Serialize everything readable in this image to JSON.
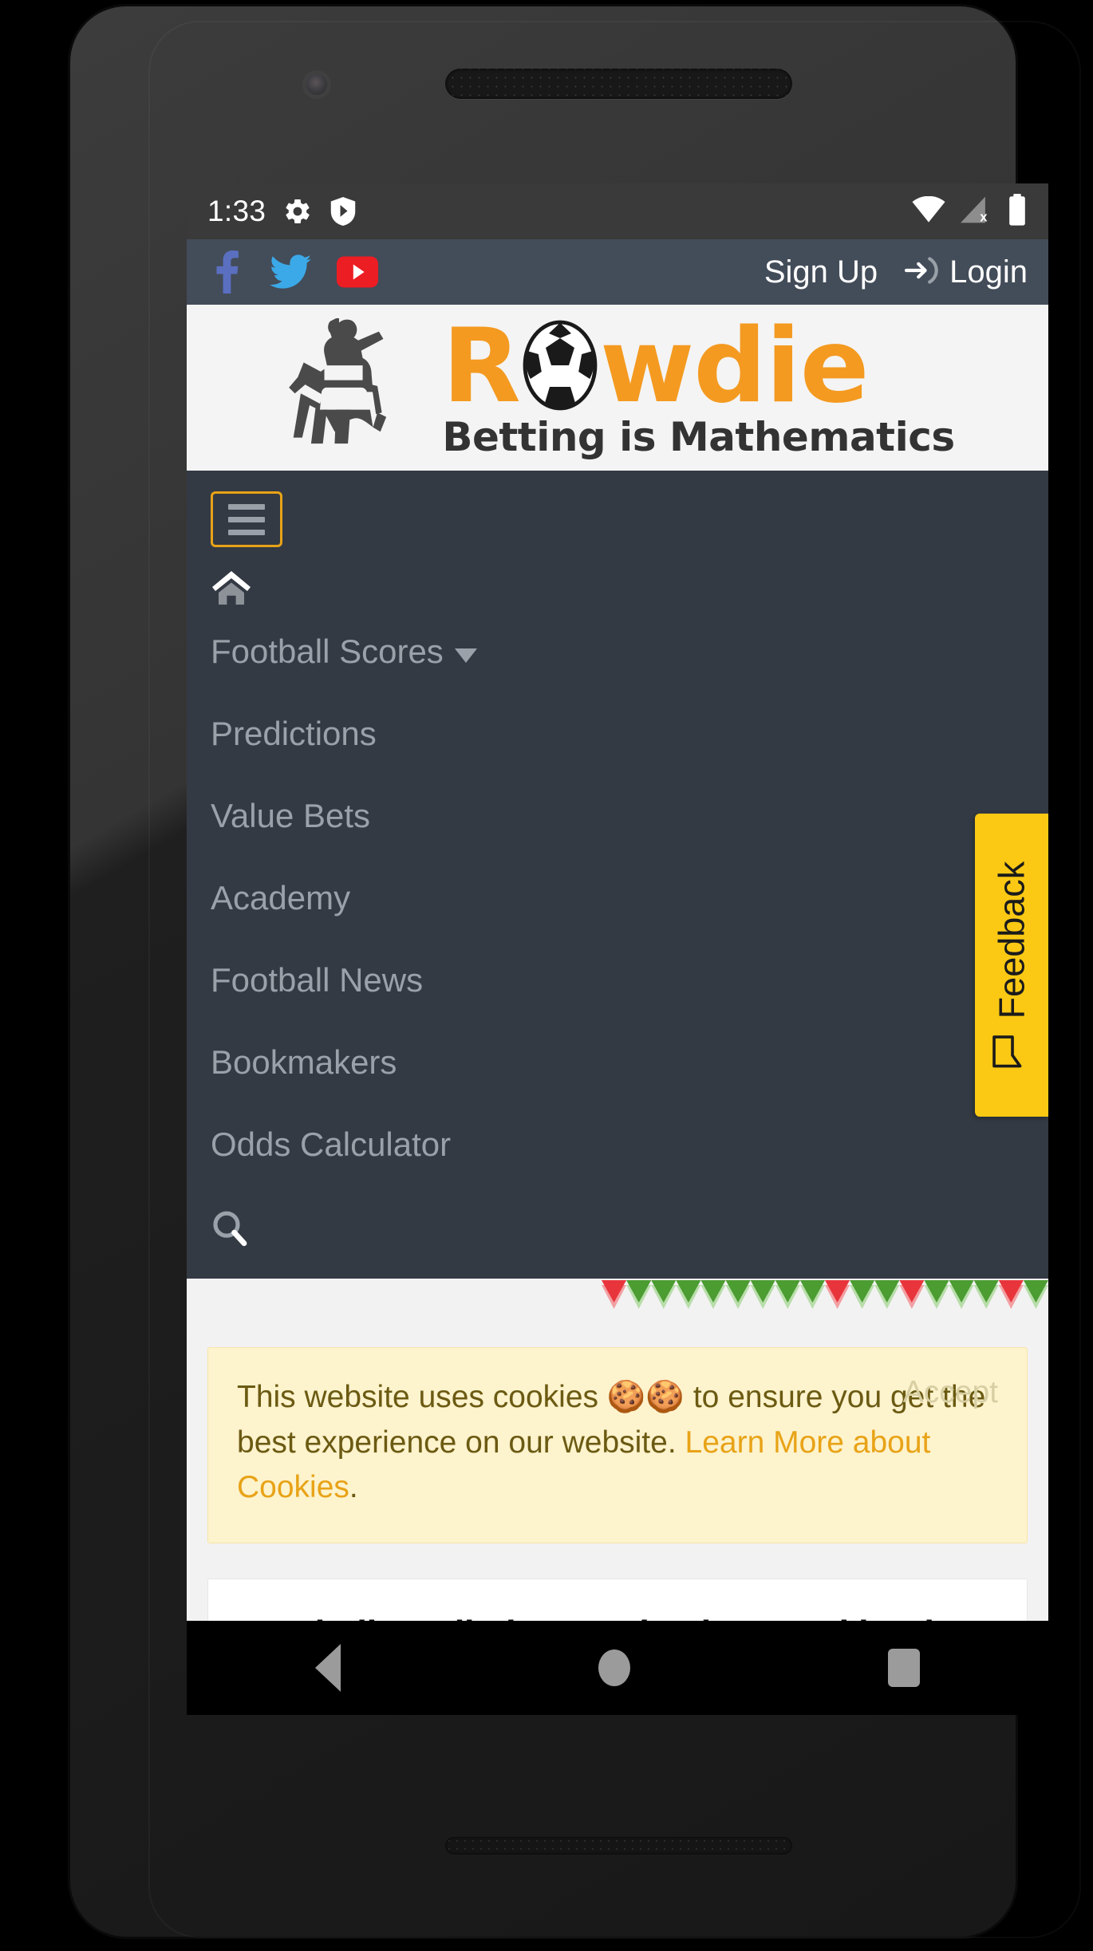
{
  "status_bar": {
    "time": "1:33",
    "left_icons": [
      "gear-icon",
      "shield-play-icon"
    ],
    "right_icons": [
      "wifi-icon",
      "cellular-no-sim-icon",
      "battery-icon"
    ]
  },
  "top_bar": {
    "social": [
      {
        "name": "facebook-icon",
        "color": "#5a6fc0"
      },
      {
        "name": "twitter-icon",
        "color": "#3ba9e8"
      },
      {
        "name": "youtube-icon",
        "color": "#ed1d24"
      }
    ],
    "sign_up_label": "Sign Up",
    "login_label": "Login",
    "login_icon": "login-arrow-icon"
  },
  "brand": {
    "name_part1": "R",
    "name_part2": "wdie",
    "ball_icon": "soccer-ball-icon",
    "tagline": "Betting is Mathematics",
    "mascot_icon": "batsman-mascot-icon",
    "orange": "#f49a20"
  },
  "nav": {
    "menu_button_icon": "hamburger-icon",
    "home_icon": "home-icon",
    "search_icon": "search-icon",
    "items": [
      {
        "label": "Football Scores",
        "has_dropdown": true
      },
      {
        "label": "Predictions",
        "has_dropdown": false
      },
      {
        "label": "Value Bets",
        "has_dropdown": false
      },
      {
        "label": "Academy",
        "has_dropdown": false
      },
      {
        "label": "Football News",
        "has_dropdown": false
      },
      {
        "label": "Bookmakers",
        "has_dropdown": false
      },
      {
        "label": "Odds Calculator",
        "has_dropdown": false
      }
    ]
  },
  "feedback_tab": {
    "label": "Feedback",
    "icon": "speech-bubble-icon",
    "color": "#fbc913"
  },
  "cookie_banner": {
    "text_before": "This website uses cookies ",
    "cookie_emoji": "🍪🍪",
    "text_middle": " to ensure you get the best experience on our website. ",
    "link_text": "Learn More about Cookies",
    "text_after": ".",
    "accept_label": "Accept"
  },
  "article": {
    "heading": "Football predictions, value bets and betting"
  },
  "form_band": {
    "colors": {
      "green": "#4b9c31",
      "red": "#e8353c"
    },
    "sequence": [
      "red",
      "green",
      "green",
      "green",
      "green",
      "green",
      "green",
      "green",
      "green",
      "red",
      "green",
      "green",
      "red",
      "green",
      "green",
      "green",
      "red",
      "green"
    ]
  },
  "android_nav": {
    "back": "back-triangle-icon",
    "home": "home-circle-icon",
    "recents": "recents-square-icon"
  }
}
